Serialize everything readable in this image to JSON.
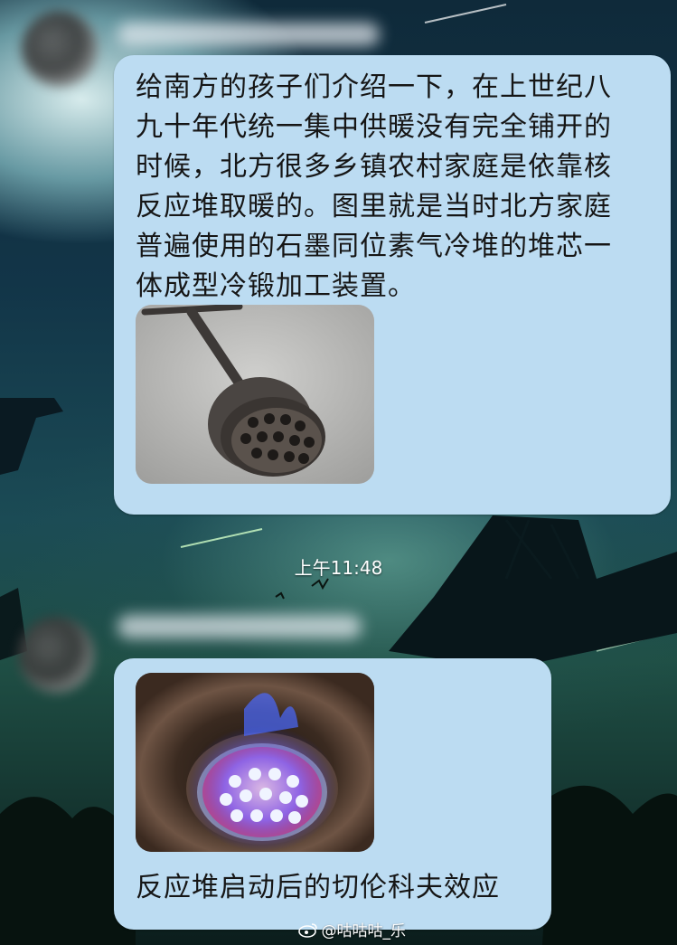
{
  "colors": {
    "bubble": "#bcdcf2",
    "text": "#161616",
    "timestamp": "#ffffff"
  },
  "messages": [
    {
      "text": "给南方的孩子们介绍一下，在上世纪八九十年代统一集中供暖没有完全铺开的时候，北方很多乡镇农村家庭是依靠核反应堆取暖的。图里就是当时北方家庭普遍使用的石墨同位素气冷堆的堆芯一体成型冷锻加工装置。",
      "image": "honeycomb-briquette-maker-photo"
    },
    {
      "image": "burning-briquette-blue-flame-photo",
      "caption": "反应堆启动后的切伦科夫效应"
    }
  ],
  "timestamp": "上午11:48",
  "watermark": {
    "icon": "weibo-icon",
    "text": "@咕咕咕_乐"
  }
}
